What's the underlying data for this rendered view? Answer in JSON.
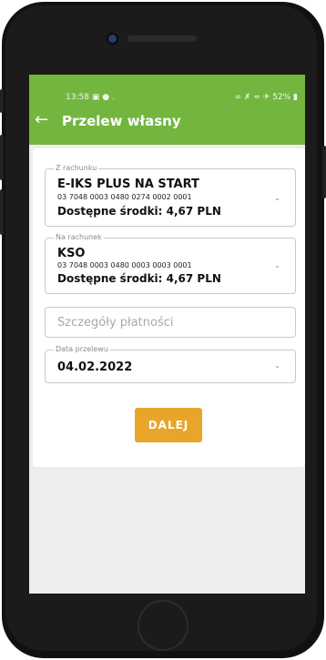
{
  "status_bar": {
    "time": "13:58",
    "battery": "52%"
  },
  "header": {
    "title": "Przelew własny",
    "back_icon": "arrow-left-icon",
    "color": "#72b640"
  },
  "from_account": {
    "legend": "Z rachunku",
    "name": "E-IKS PLUS NA START",
    "number": "03 7048 0003 0480 0274 0002 0001",
    "available": "Dostępne środki: 4,67 PLN"
  },
  "to_account": {
    "legend": "Na rachunek",
    "name": "KSO",
    "number": "03 7048 0003 0480 0003 0003 0001",
    "available": "Dostępne środki: 4,67 PLN"
  },
  "details": {
    "placeholder": "Szczegóły płatności"
  },
  "transfer_date": {
    "legend": "Data przelewu",
    "value": "04.02.2022"
  },
  "next_button": {
    "label": "DALEJ",
    "color": "#e7a62a"
  }
}
